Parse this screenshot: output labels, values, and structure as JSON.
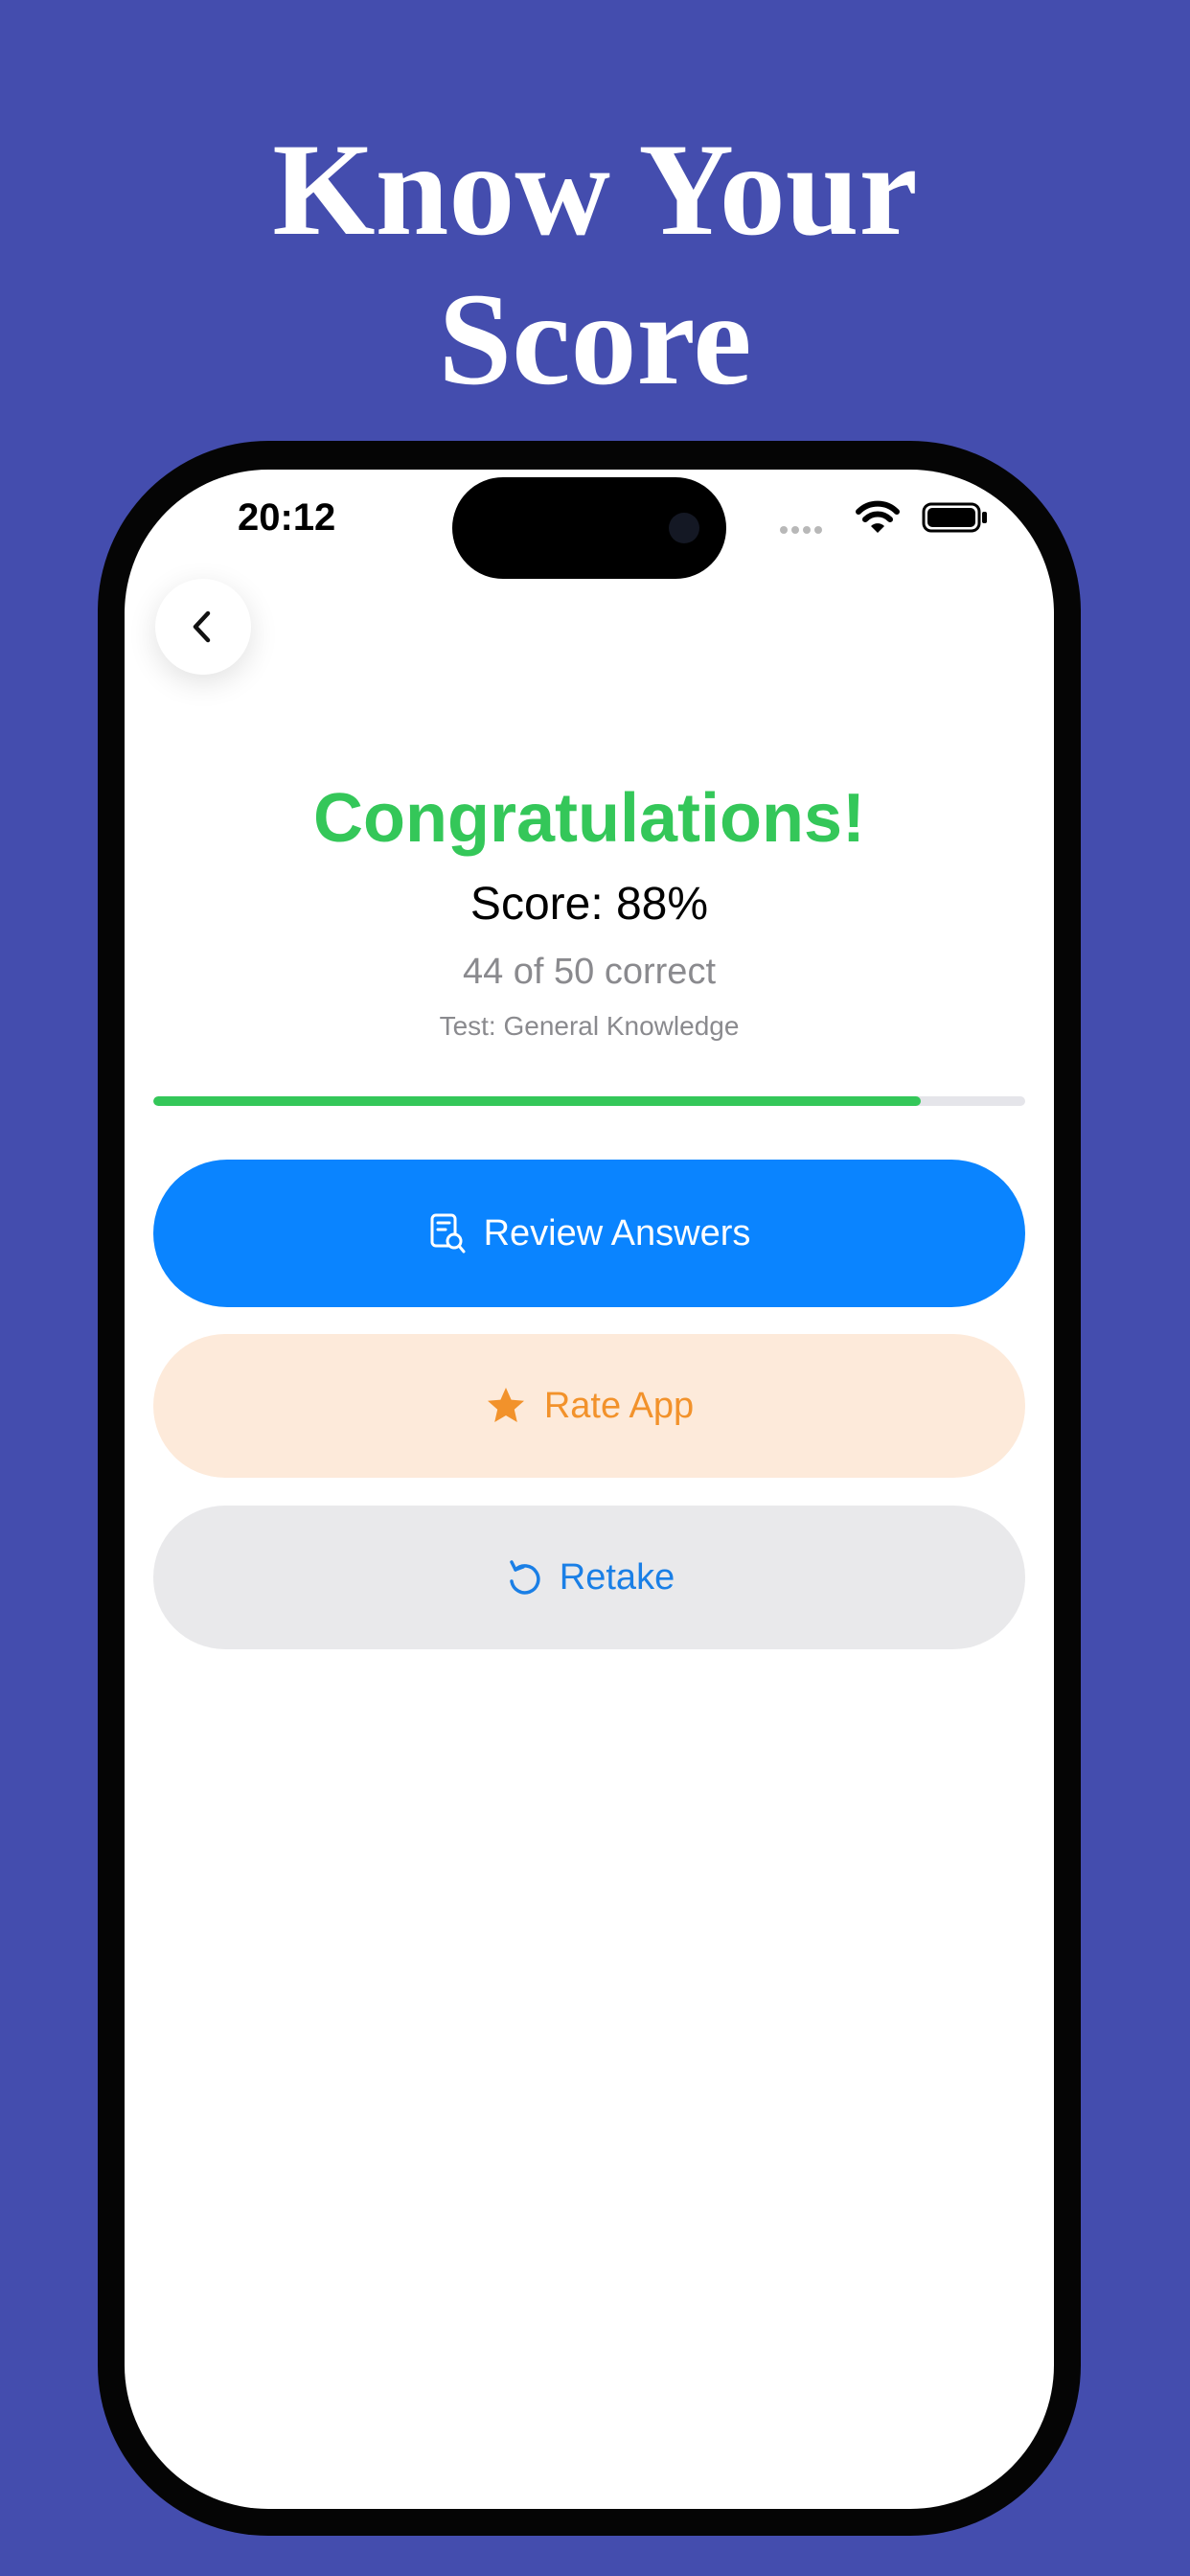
{
  "promo": {
    "headline_line1": "Know Your",
    "headline_line2": "Score"
  },
  "status_bar": {
    "time": "20:12"
  },
  "results": {
    "title": "Congratulations!",
    "score_text": "Score: 88%",
    "correct_text": "44 of 50 correct",
    "test_text": "Test: General Knowledge",
    "progress_fraction": 0.88
  },
  "actions": {
    "review_label": "Review Answers",
    "rate_label": "Rate App",
    "retake_label": "Retake"
  },
  "colors": {
    "background": "#444DAE",
    "success": "#34C759",
    "primary": "#0A84FF",
    "rate_bg": "#FDEADA",
    "rate_text": "#F2922B",
    "neutral_bg": "#E9E9EB"
  },
  "icons": {
    "back": "chevron-left-icon",
    "review": "document-search-icon",
    "rate": "star-icon",
    "retake": "arrow-counterclockwise-icon"
  }
}
